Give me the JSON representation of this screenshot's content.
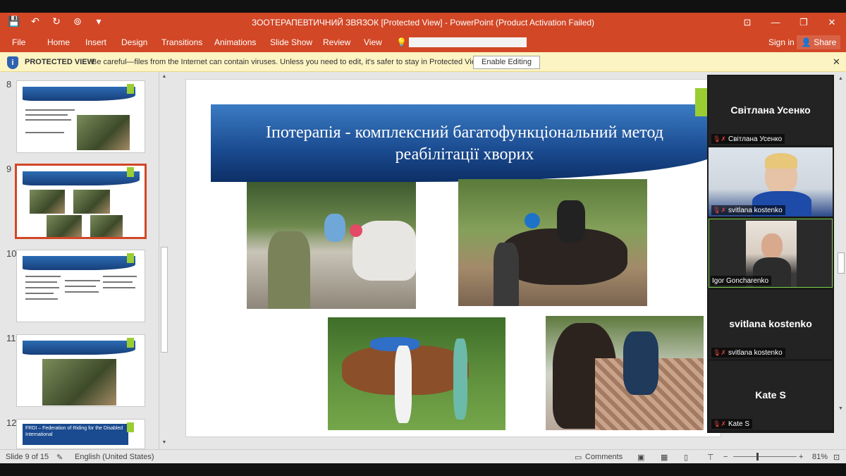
{
  "window": {
    "title": "ЗООТЕРАПЕВТИЧНИЙ ЗВЯЗОК [Protected View] - PowerPoint (Product Activation Failed)",
    "controls": [
      "⊡",
      "—",
      "❐",
      "✕"
    ]
  },
  "qat": {
    "save_icon": "💾",
    "undo_icon": "↶",
    "redo_icon": "↻",
    "present_icon": "⊚",
    "more_icon": "▾"
  },
  "ribbon": {
    "tabs": [
      "File",
      "Home",
      "Insert",
      "Design",
      "Transitions",
      "Animations",
      "Slide Show",
      "Review",
      "View"
    ],
    "tell_me_icon": "💡",
    "sign_in": "Sign in",
    "share": "Share",
    "share_icon": "👤"
  },
  "protected": {
    "label": "PROTECTED VIEW",
    "message": "Be careful—files from the Internet can contain viruses. Unless you need to edit, it's safer to stay in Protected View.",
    "button": "Enable Editing",
    "close": "✕",
    "shield": "i"
  },
  "thumbnails": [
    {
      "number": "8"
    },
    {
      "number": "9",
      "selected": true
    },
    {
      "number": "10"
    },
    {
      "number": "11"
    },
    {
      "number": "12",
      "caption": "FRDI – Federation of Riding for the Disabled International"
    }
  ],
  "slide": {
    "title_line1": "Іпотерапія - комплексний багатофункціональний метод",
    "title_line2": "реабілітації хворих"
  },
  "participants": [
    {
      "display": "Світлана Усенко",
      "label": "Світлана Усенко",
      "video": false
    },
    {
      "label": "svitlana kostenko",
      "video": true
    },
    {
      "label": "Igor Goncharenko",
      "video": true,
      "active": true
    },
    {
      "display": "svitlana kostenko",
      "label": "svitlana kostenko",
      "video": false
    },
    {
      "display": "Kate S",
      "label": "Kate S",
      "video": false
    }
  ],
  "mute_icon": "🎙✗",
  "status": {
    "slide_of": "Slide 9 of 15",
    "language": "English (United States)",
    "comments": "Comments",
    "zoom": "81%",
    "zoom_minus": "−",
    "zoom_plus": "+"
  }
}
